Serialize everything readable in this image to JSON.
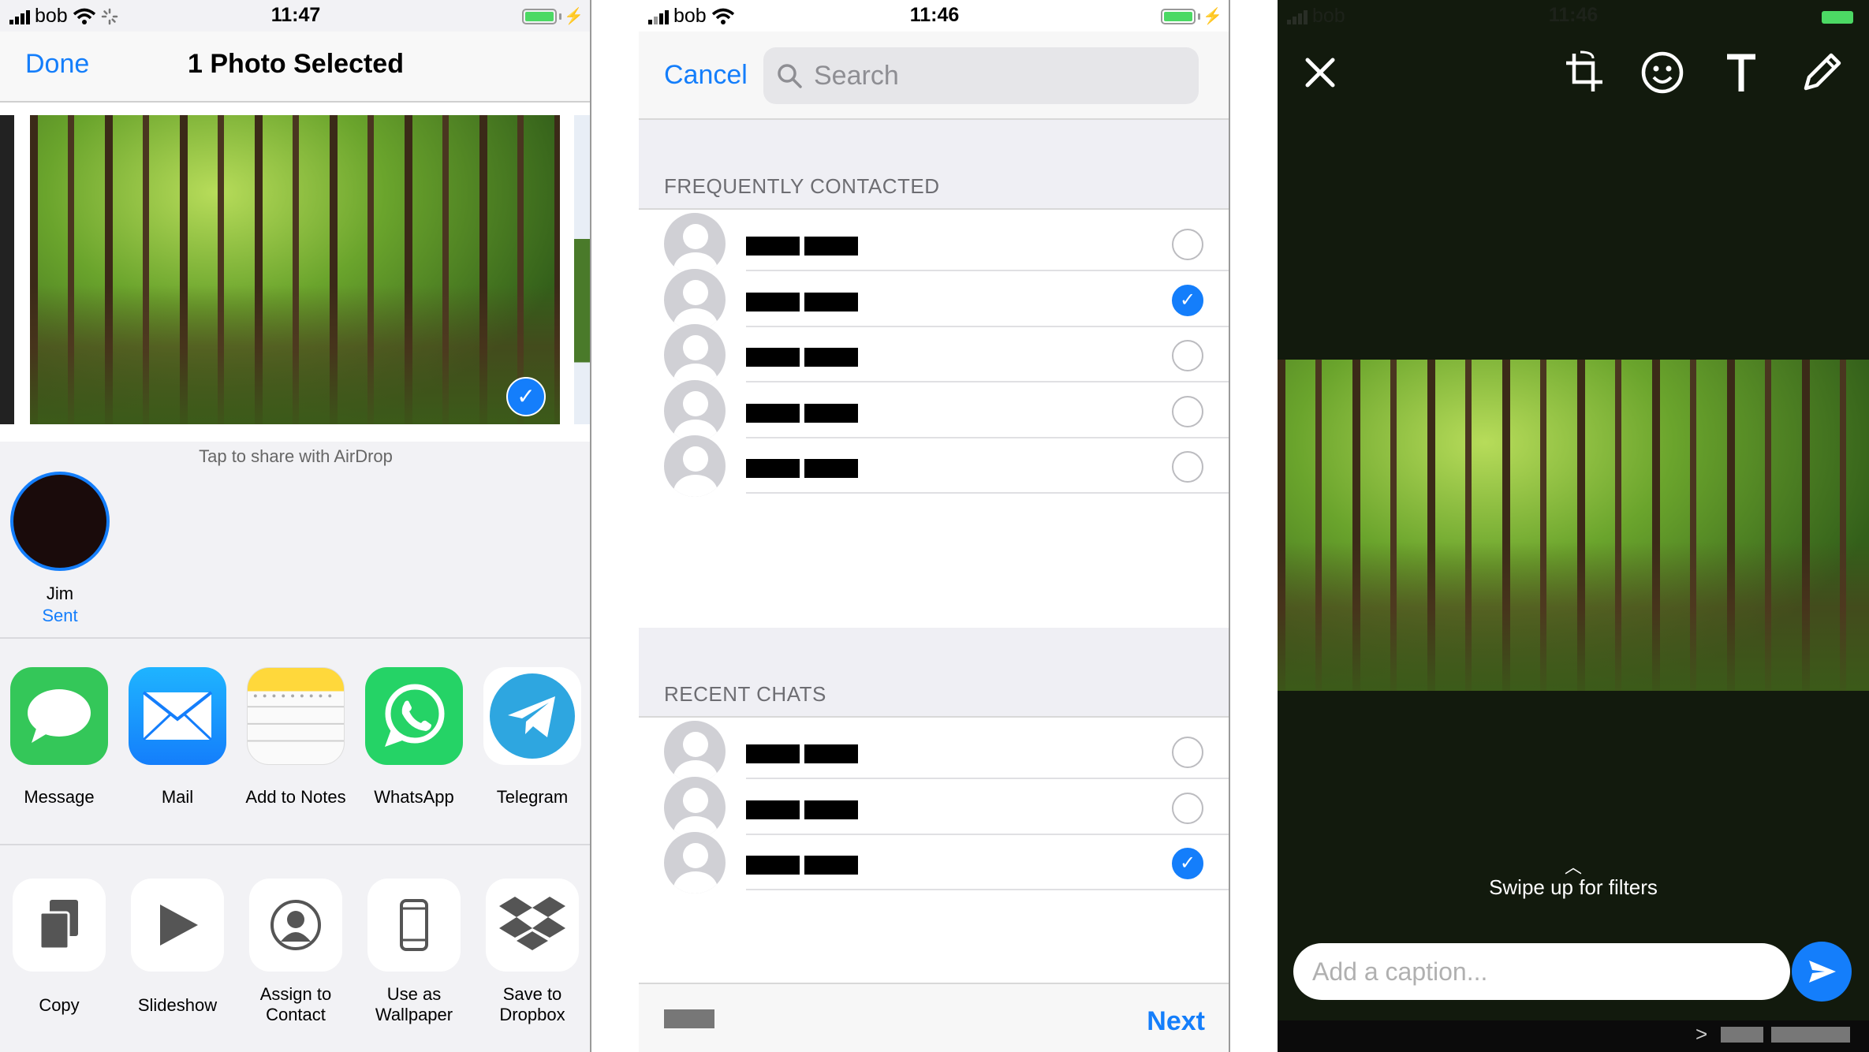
{
  "screen1": {
    "status": {
      "carrier": "bob",
      "time": "11:47"
    },
    "nav": {
      "done": "Done",
      "title": "1 Photo Selected"
    },
    "airdrop_hint": "Tap to share with AirDrop",
    "airdrop_person": {
      "name": "Jim",
      "status": "Sent"
    },
    "apps": [
      {
        "label": "Message",
        "icon": "message-icon"
      },
      {
        "label": "Mail",
        "icon": "mail-icon"
      },
      {
        "label": "Add to Notes",
        "icon": "notes-icon"
      },
      {
        "label": "WhatsApp",
        "icon": "whatsapp-icon"
      },
      {
        "label": "Telegram",
        "icon": "telegram-icon"
      }
    ],
    "actions": [
      {
        "label": "Copy",
        "icon": "copy-icon"
      },
      {
        "label": "Slideshow",
        "icon": "play-icon"
      },
      {
        "label": "Assign to Contact",
        "icon": "contact-icon"
      },
      {
        "label": "Use as Wallpaper",
        "icon": "phone-icon"
      },
      {
        "label": "Save to Dropbox",
        "icon": "dropbox-icon"
      }
    ]
  },
  "screen2": {
    "status": {
      "carrier": "bob",
      "time": "11:46"
    },
    "cancel": "Cancel",
    "search_placeholder": "Search",
    "sections": {
      "frequent": "FREQUENTLY CONTACTED",
      "recent": "RECENT CHATS"
    },
    "frequent_selected": [
      false,
      true,
      false,
      false,
      false
    ],
    "recent_selected": [
      false,
      false,
      true
    ],
    "next": "Next"
  },
  "screen3": {
    "status": {
      "carrier": "bob",
      "time": "11:46"
    },
    "swipe_hint": "Swipe up for filters",
    "caption_placeholder": "Add a caption..."
  },
  "colors": {
    "accent": "#147efb",
    "whatsapp_green": "#25d366",
    "message_green": "#34c759",
    "editor_bg": "#121a0d"
  }
}
